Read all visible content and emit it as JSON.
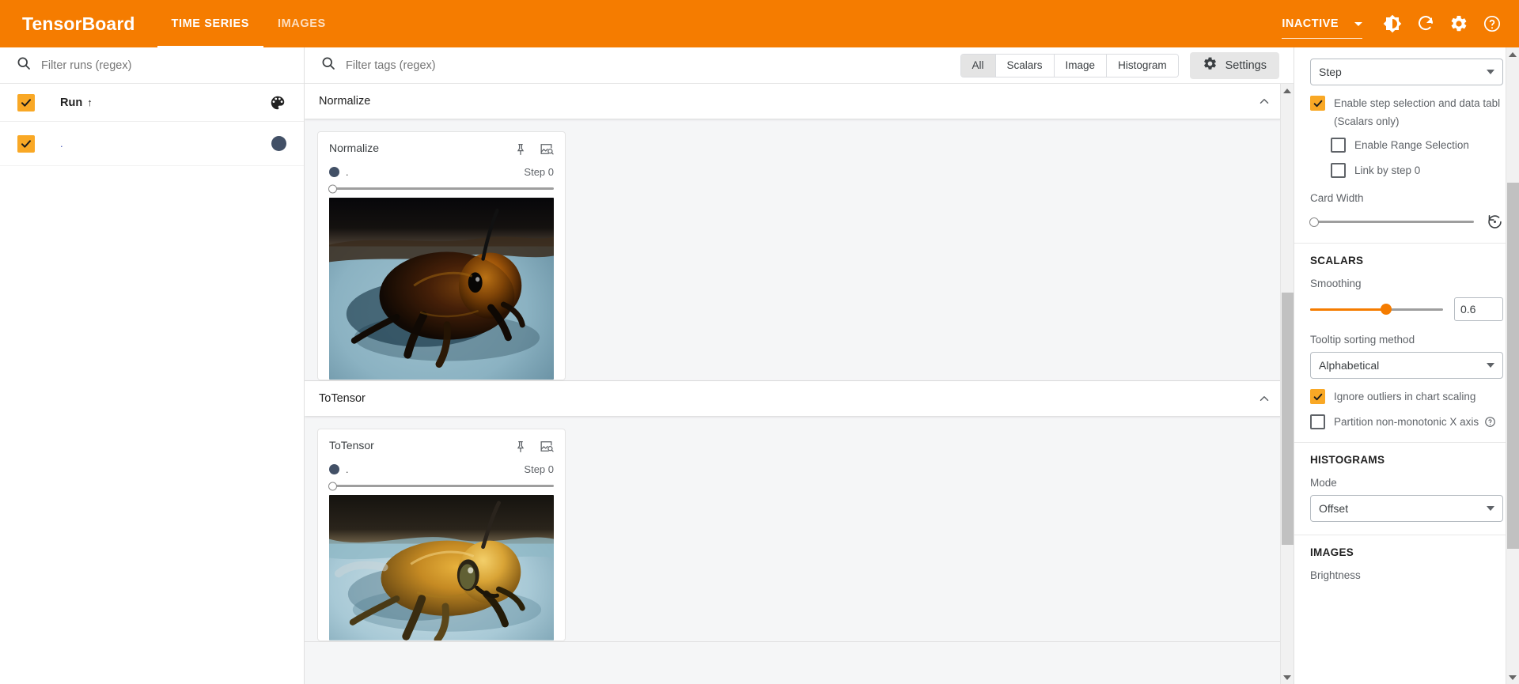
{
  "header": {
    "brand": "TensorBoard",
    "tabs": [
      {
        "label": "TIME SERIES",
        "active": true
      },
      {
        "label": "IMAGES",
        "active": false
      }
    ],
    "status": "INACTIVE",
    "icons": {
      "dropdown": "chevron-down-icon",
      "brightness": "brightness-icon",
      "refresh": "refresh-icon",
      "settings": "gear-icon",
      "help": "help-icon"
    }
  },
  "runs_panel": {
    "filter_placeholder": "Filter runs (regex)",
    "filter_value": "",
    "column_header": "Run",
    "sort_arrow": "↑",
    "palette_icon": "palette-icon",
    "items": [
      {
        "name": ".",
        "checked": true,
        "color": "#425066"
      }
    ]
  },
  "tagbar": {
    "filter_placeholder": "Filter tags (regex)",
    "filter_value": "",
    "toggles": [
      {
        "label": "All",
        "selected": true
      },
      {
        "label": "Scalars",
        "selected": false
      },
      {
        "label": "Image",
        "selected": false
      },
      {
        "label": "Histogram",
        "selected": false
      }
    ],
    "settings_label": "Settings",
    "settings_icon": "gear-icon"
  },
  "groups": [
    {
      "title": "Normalize",
      "collapse_icon": "chevron-up-icon",
      "cards": [
        {
          "title": "Normalize",
          "pin_icon": "pin-icon",
          "fullscreen_icon": "image-search-icon",
          "run_name": ".",
          "run_color": "#425066",
          "step_label": "Step 0",
          "slider_value": 0,
          "image_alt": "dark-normalized-bee-photo"
        }
      ]
    },
    {
      "title": "ToTensor",
      "collapse_icon": "chevron-up-icon",
      "cards": [
        {
          "title": "ToTensor",
          "pin_icon": "pin-icon",
          "fullscreen_icon": "image-search-icon",
          "run_name": ".",
          "run_color": "#425066",
          "step_label": "Step 0",
          "slider_value": 0,
          "image_alt": "golden-bee-photo"
        }
      ]
    }
  ],
  "settings": {
    "general": {
      "step_select_value": "Step",
      "enable_step_selection_label": "Enable step selection and data tabl",
      "enable_step_selection_checked": true,
      "scalars_only_note": "(Scalars only)",
      "enable_range_selection_label": "Enable Range Selection",
      "enable_range_selection_checked": false,
      "link_by_step_label": "Link by step 0",
      "link_by_step_checked": false,
      "card_width_label": "Card Width",
      "card_width_value": 0,
      "card_width_reset_icon": "reset-icon"
    },
    "scalars": {
      "heading": "SCALARS",
      "smoothing_label": "Smoothing",
      "smoothing_value": "0.6",
      "tooltip_sorting_label": "Tooltip sorting method",
      "tooltip_sorting_value": "Alphabetical",
      "ignore_outliers_label": "Ignore outliers in chart scaling",
      "ignore_outliers_checked": true,
      "partition_label": "Partition non-monotonic X axis",
      "partition_checked": false,
      "partition_help_icon": "help-icon"
    },
    "histograms": {
      "heading": "HISTOGRAMS",
      "mode_label": "Mode",
      "mode_value": "Offset"
    },
    "images": {
      "heading": "IMAGES",
      "brightness_label": "Brightness"
    }
  },
  "colors": {
    "brand_orange": "#f57c00",
    "accent_amber": "#f9a825",
    "run_color": "#425066"
  }
}
